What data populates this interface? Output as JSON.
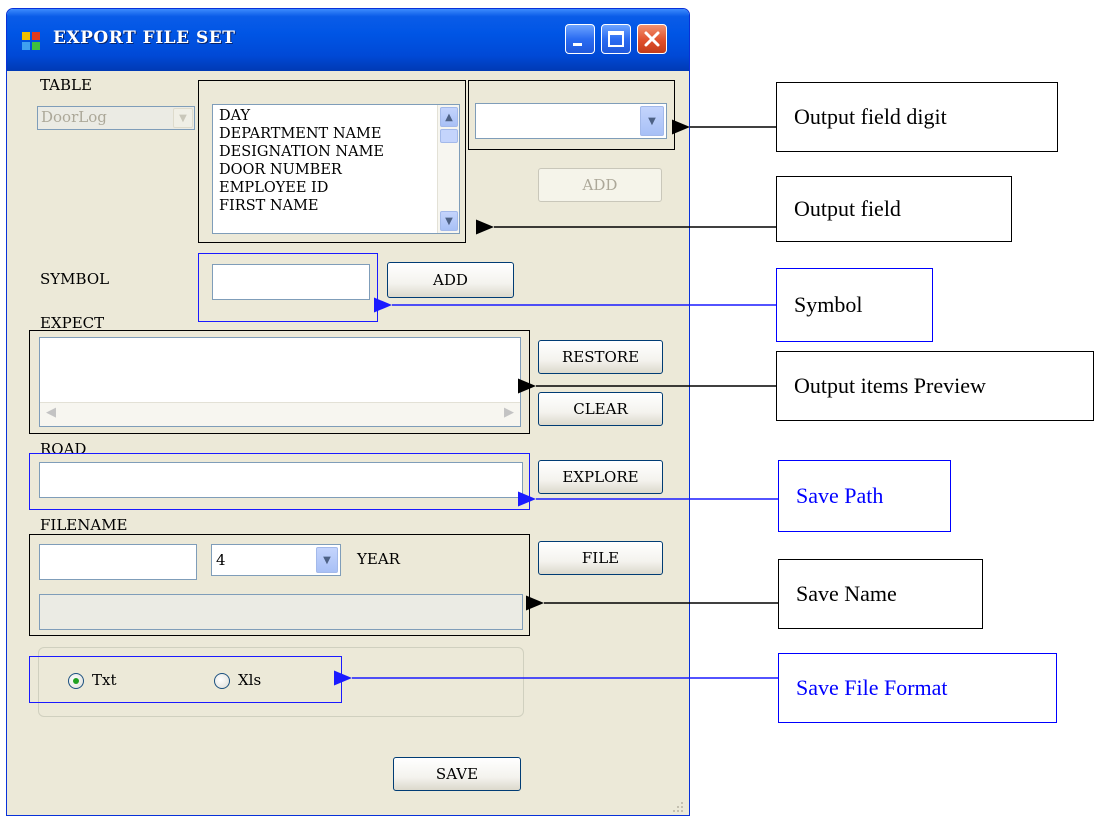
{
  "window": {
    "title": "EXPORT FILE SET"
  },
  "table": {
    "label": "TABLE",
    "selected": "DoorLog"
  },
  "output_field": {
    "items": [
      "DAY",
      "DEPARTMENT NAME",
      "DESIGNATION NAME",
      "DOOR NUMBER",
      "EMPLOYEE ID",
      "FIRST NAME"
    ]
  },
  "digit": {
    "selected": ""
  },
  "add_field_button": "ADD",
  "symbol": {
    "label": "SYMBOL",
    "value": "",
    "add_button": "ADD"
  },
  "expect": {
    "label": "EXPECT",
    "value": "",
    "restore_button": "RESTORE",
    "clear_button": "CLEAR"
  },
  "road": {
    "label": "ROAD",
    "value": "",
    "explore_button": "EXPLORE"
  },
  "filename": {
    "label": "FILENAME",
    "value": "",
    "year_digits": "4",
    "year_label": "YEAR",
    "file_button": "FILE",
    "preview": ""
  },
  "format": {
    "options": [
      "Txt",
      "Xls"
    ],
    "selected": "Txt"
  },
  "save_button": "SAVE",
  "annotations": {
    "digit": "Output field digit",
    "field": "Output field",
    "symbol": "Symbol",
    "preview": "Output items Preview",
    "path": "Save Path",
    "name": "Save Name",
    "format": "Save File Format"
  },
  "colors": {
    "annotation_blue": "#0000ff",
    "window_face": "#ece9d8",
    "titlebar": "#0055e5"
  }
}
